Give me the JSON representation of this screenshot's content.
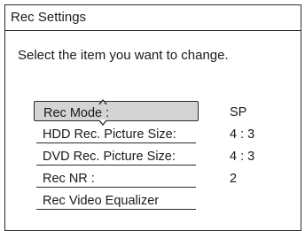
{
  "window": {
    "title": "Rec Settings"
  },
  "instruction": "Select the item you want to change.",
  "menu": {
    "items": [
      {
        "label": "Rec Mode :",
        "value": "SP"
      },
      {
        "label": "HDD Rec. Picture Size:",
        "value": "4 : 3"
      },
      {
        "label": "DVD Rec. Picture Size:",
        "value": "4 : 3"
      },
      {
        "label": "Rec NR :",
        "value": "2"
      },
      {
        "label": "Rec Video Equalizer",
        "value": ""
      }
    ]
  },
  "icons": {
    "up": "arrow-up-icon",
    "down": "arrow-down-icon"
  }
}
